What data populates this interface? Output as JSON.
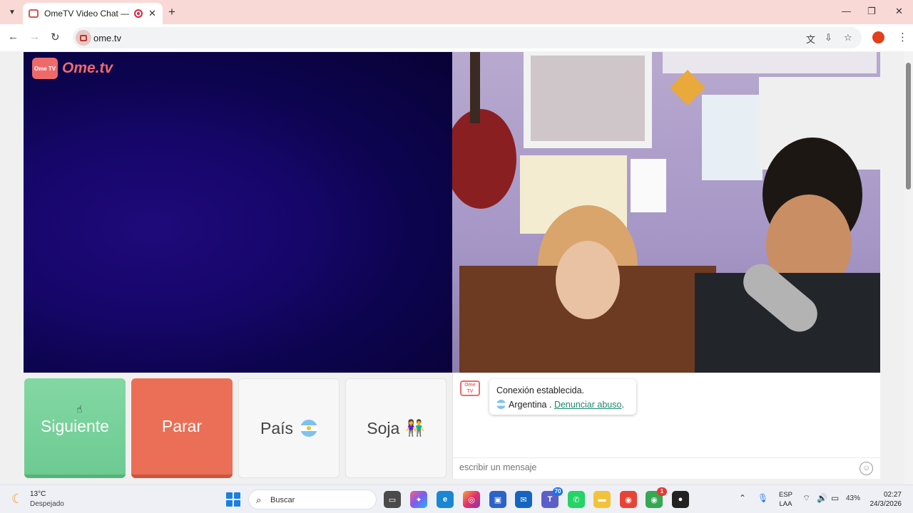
{
  "browser": {
    "tab_title": "OmeTV Video Chat — Alterr",
    "url": "ome.tv"
  },
  "site": {
    "logo_icon_text": "Ome TV",
    "logo_text": "Ome.tv"
  },
  "actions": {
    "next_label": "Siguiente",
    "stop_label": "Parar",
    "country_label": "País",
    "gender_label": "Soja"
  },
  "chat": {
    "avatar_text": "Ome TV",
    "status_message": "Conexión establecida.",
    "country": "Argentina",
    "separator": " . ",
    "report_link": "Denunciar abuso",
    "report_suffix": ".",
    "input_placeholder": "escribir un mensaje"
  },
  "taskbar": {
    "weather_temp": "13°C",
    "weather_desc": "Despejado",
    "search_placeholder": "Buscar",
    "teams_badge": "70",
    "chrome_badge": "1",
    "battery": "43%",
    "lang_top": "ESP",
    "lang_bottom": "LAA",
    "time": "02:27",
    "date": "24/3/2026"
  },
  "colors": {
    "next_button": "#6dcb92",
    "stop_button": "#ea6f56",
    "brand": "#ee6a6a",
    "link": "#1d8a6c"
  }
}
